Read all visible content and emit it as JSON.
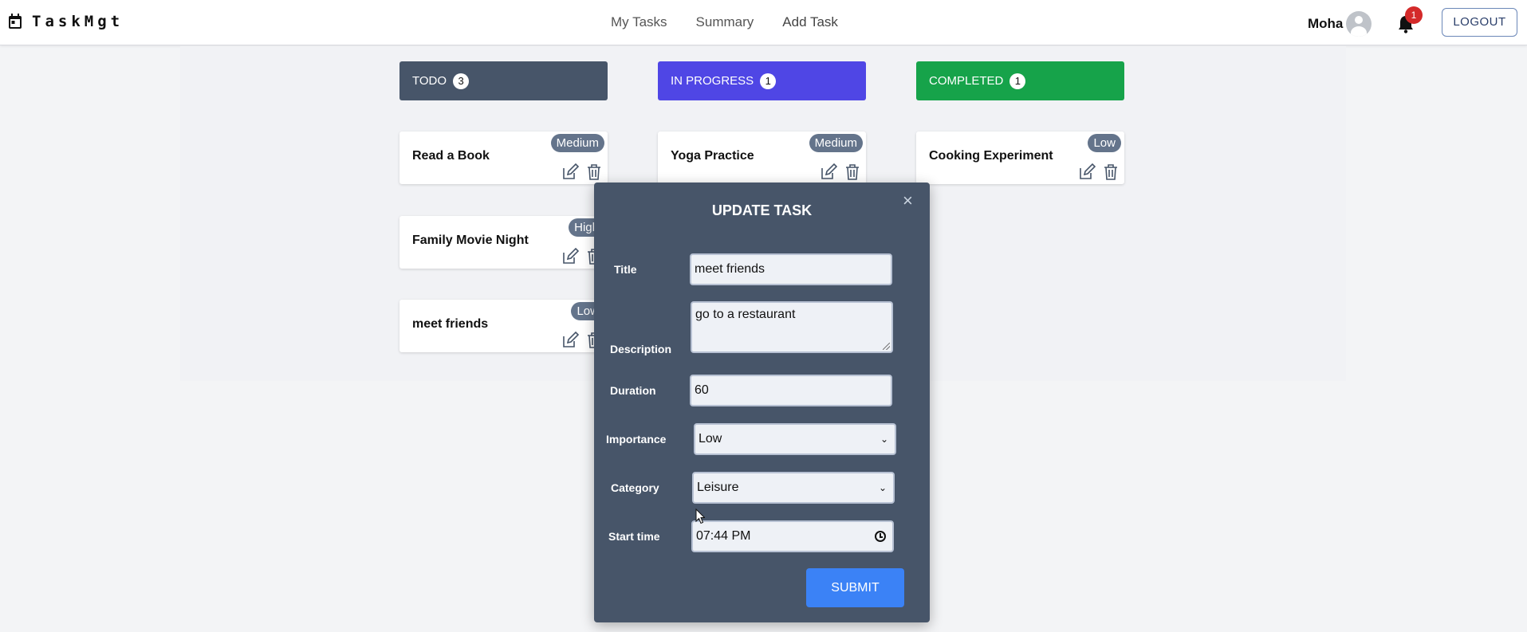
{
  "app": {
    "logo_text": "TaskMgt"
  },
  "nav": {
    "items": [
      "My Tasks",
      "Summary",
      "Add Task"
    ]
  },
  "user": {
    "name": "Moha",
    "notification_count": "1",
    "logout_label": "LOGOUT"
  },
  "columns": [
    {
      "title": "TODO",
      "count": "3",
      "color": "#475569"
    },
    {
      "title": "IN PROGRESS",
      "count": "1",
      "color": "#4f46e5"
    },
    {
      "title": "COMPLETED",
      "count": "1",
      "color": "#16a34a"
    }
  ],
  "cards": {
    "todo": [
      {
        "title": "Read a Book",
        "priority": "Medium"
      },
      {
        "title": "Family Movie Night",
        "priority": "High"
      },
      {
        "title": "meet friends",
        "priority": "Low"
      }
    ],
    "in_progress": [
      {
        "title": "Yoga Practice",
        "priority": "Medium"
      }
    ],
    "completed": [
      {
        "title": "Cooking Experiment",
        "priority": "Low"
      }
    ]
  },
  "modal": {
    "title": "UPDATE TASK",
    "close_symbol": "×",
    "labels": {
      "title": "Title",
      "description": "Description",
      "duration": "Duration",
      "importance": "Importance",
      "category": "Category",
      "start_time": "Start time"
    },
    "values": {
      "title": "meet friends",
      "description": "go to a restaurant",
      "duration": "60",
      "importance": "Low",
      "category": "Leisure",
      "start_time": "07:44 PM"
    },
    "submit_label": "SUBMIT"
  },
  "icons": {
    "logo": "calendar-icon",
    "edit": "edit-icon",
    "delete": "trash-icon",
    "bell": "bell-icon",
    "avatar": "user-avatar-icon"
  }
}
